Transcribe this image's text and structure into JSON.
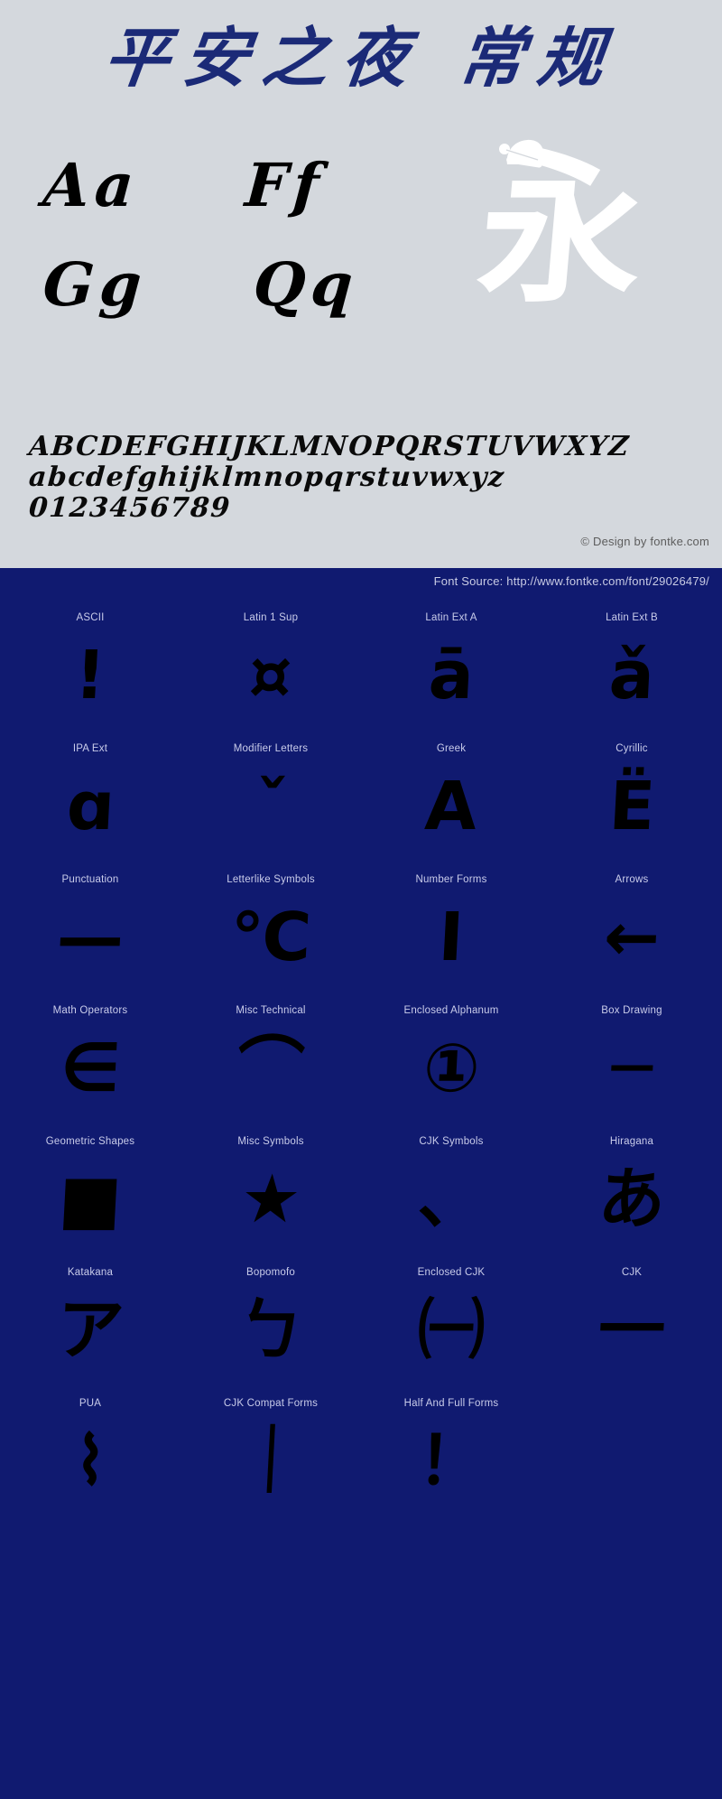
{
  "colors": {
    "page_background": "#d4d8dd",
    "panel_blue": "#101a70",
    "title_navy": "#1b2a77",
    "glyph_black": "#000000",
    "specimen_white": "#ffffff",
    "label_text": "#c9ccea",
    "copyright_text": "#5d5d5d"
  },
  "preview": {
    "title": "平安之夜 常规",
    "sample_rows": [
      {
        "left": "Aa",
        "right": "Ff"
      },
      {
        "left": "Gg",
        "right": "Qq"
      }
    ],
    "specimen_glyph": "永",
    "specimen_decoration": "santa-hat",
    "alphabet": {
      "uppercase": "ABCDEFGHIJKLMNOPQRSTUVWXYZ",
      "lowercase": "abcdefghijklmnopqrstuvwxyz",
      "digits": "0123456789"
    },
    "copyright": "© Design by fontke.com"
  },
  "coverage": {
    "font_source": "Font Source: http://www.fontke.com/font/29026479/",
    "cells": [
      {
        "label": "ASCII",
        "glyph": "!"
      },
      {
        "label": "Latin 1 Sup",
        "glyph": "¤"
      },
      {
        "label": "Latin Ext A",
        "glyph": "ā"
      },
      {
        "label": "Latin Ext B",
        "glyph": "ǎ"
      },
      {
        "label": "IPA Ext",
        "glyph": "ɑ"
      },
      {
        "label": "Modifier Letters",
        "glyph": "ˇ"
      },
      {
        "label": "Greek",
        "glyph": "Α"
      },
      {
        "label": "Cyrillic",
        "glyph": "Ё"
      },
      {
        "label": "Punctuation",
        "glyph": "—"
      },
      {
        "label": "Letterlike Symbols",
        "glyph": "℃"
      },
      {
        "label": "Number Forms",
        "glyph": "Ⅰ"
      },
      {
        "label": "Arrows",
        "glyph": "←"
      },
      {
        "label": "Math Operators",
        "glyph": "∈"
      },
      {
        "label": "Misc Technical",
        "glyph": "⌒"
      },
      {
        "label": "Enclosed Alphanum",
        "glyph": "①"
      },
      {
        "label": "Box Drawing",
        "glyph": "─"
      },
      {
        "label": "Geometric Shapes",
        "glyph": "■"
      },
      {
        "label": "Misc Symbols",
        "glyph": "★"
      },
      {
        "label": "CJK Symbols",
        "glyph": "、"
      },
      {
        "label": "Hiragana",
        "glyph": "あ"
      },
      {
        "label": "Katakana",
        "glyph": "ア"
      },
      {
        "label": "Bopomofo",
        "glyph": "ㄅ"
      },
      {
        "label": "Enclosed CJK",
        "glyph": "㈠"
      },
      {
        "label": "CJK",
        "glyph": "一"
      },
      {
        "label": "PUA",
        "glyph": "⌇"
      },
      {
        "label": "CJK Compat Forms",
        "glyph": "｜"
      },
      {
        "label": "Half And Full Forms",
        "glyph": "！"
      },
      {
        "label": "",
        "glyph": ""
      }
    ]
  }
}
